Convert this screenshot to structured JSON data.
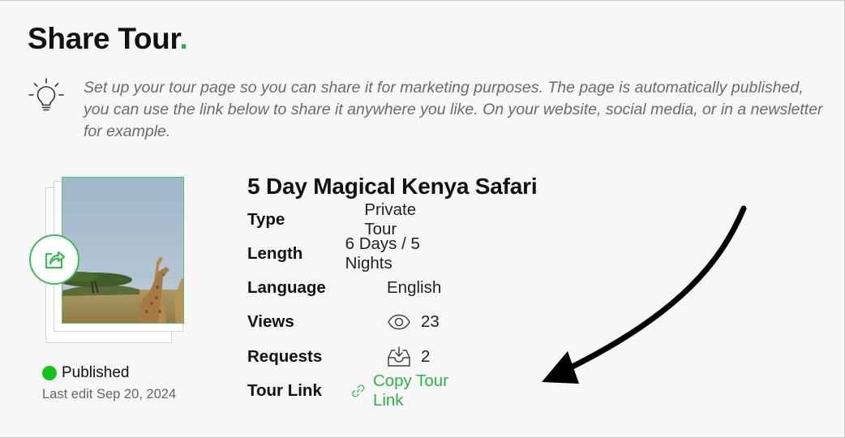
{
  "page": {
    "title": "Share Tour",
    "title_dot": ".",
    "tip_text": "Set up your tour page so you can share it for marketing purposes. The page is automatically published, you can use the link below to share it anywhere you like. On your website, social media, or in a newsletter for example."
  },
  "tour": {
    "name": "5 Day Magical Kenya Safari",
    "status": "Published",
    "last_edit": "Last edit Sep 20, 2024",
    "details": [
      {
        "label": "Type",
        "value": "Private Tour"
      },
      {
        "label": "Length",
        "value": "6 Days / 5 Nights"
      },
      {
        "label": "Language",
        "value": "English"
      },
      {
        "label": "Views",
        "value": "23",
        "icon": "eye-icon"
      },
      {
        "label": "Requests",
        "value": "2",
        "icon": "inbox-icon"
      },
      {
        "label": "Tour Link",
        "value": "Copy Tour Link",
        "icon": "link-icon"
      }
    ]
  },
  "icons": {
    "tip": "lightbulb-icon",
    "share": "share-icon"
  },
  "colors": {
    "accent": "#2eb34a",
    "status_published": "#15c21c",
    "tip_text": "#6b6b6b"
  }
}
